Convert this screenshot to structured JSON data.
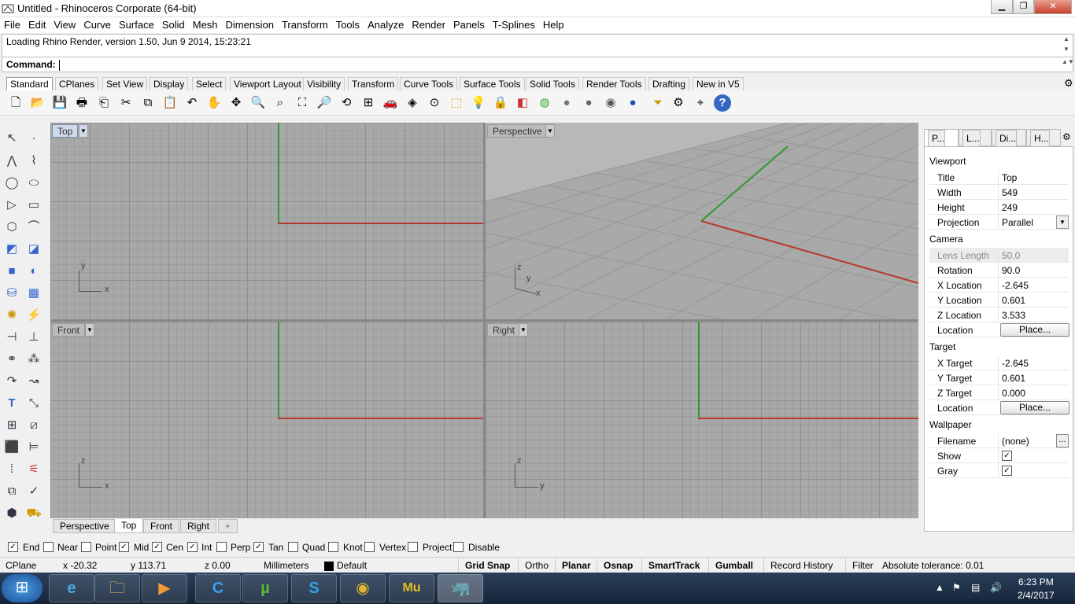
{
  "window": {
    "title": "Untitled - Rhinoceros Corporate (64-bit)"
  },
  "menu": [
    "File",
    "Edit",
    "View",
    "Curve",
    "Surface",
    "Solid",
    "Mesh",
    "Dimension",
    "Transform",
    "Tools",
    "Analyze",
    "Render",
    "Panels",
    "T-Splines",
    "Help"
  ],
  "history": {
    "line": "Loading Rhino Render, version 1.50, Jun  9 2014, 15:23:21"
  },
  "command": {
    "label": "Command:",
    "value": ""
  },
  "toolbar_tabs": [
    "Standard",
    "CPlanes",
    "Set View",
    "Display",
    "Select",
    "Viewport Layout",
    "Visibility",
    "Transform",
    "Curve Tools",
    "Surface Tools",
    "Solid Tools",
    "Render Tools",
    "Drafting",
    "New in V5"
  ],
  "toolbar_icons": [
    "new-icon",
    "open-icon",
    "save-icon",
    "print-icon",
    "import-icon",
    "cut-icon",
    "copy-icon",
    "paste-icon",
    "undo-icon",
    "pan-icon",
    "rotate-view-icon",
    "zoom-dynamic-icon",
    "zoom-window-icon",
    "zoom-extents-icon",
    "zoom-selected-icon",
    "undo-view-icon",
    "four-viewports-icon",
    "car-icon",
    "render-preview-icon",
    "cplane-icon",
    "select-icon",
    "light-icon",
    "lock-icon",
    "layer-icon",
    "color-wheel-icon",
    "shade-icon",
    "rendered-icon",
    "ghosted-icon",
    "material-icon",
    "filter-icon",
    "options-icon",
    "osnap-icon",
    "help-icon"
  ],
  "viewports": {
    "top": "Top",
    "perspective": "Perspective",
    "front": "Front",
    "right": "Right"
  },
  "axis_labels": {
    "top": [
      "y",
      "x"
    ],
    "perspective": [
      "z",
      "y",
      "x"
    ],
    "front": [
      "z",
      "x"
    ],
    "right": [
      "z",
      "y"
    ]
  },
  "viewport_tabs": [
    "Perspective",
    "Top",
    "Front",
    "Right",
    "+"
  ],
  "panel": {
    "tabs": [
      "P...",
      "L...",
      "Di...",
      "H..."
    ],
    "viewport_header": "Viewport",
    "title_label": "Title",
    "title_value": "Top",
    "width_label": "Width",
    "width_value": "549",
    "height_label": "Height",
    "height_value": "249",
    "projection_label": "Projection",
    "projection_value": "Parallel",
    "camera_header": "Camera",
    "lens_label": "Lens Length",
    "lens_value": "50.0",
    "rotation_label": "Rotation",
    "rotation_value": "90.0",
    "xloc_label": "X Location",
    "xloc_value": "-2.645",
    "yloc_label": "Y Location",
    "yloc_value": "0.601",
    "zloc_label": "Z Location",
    "zloc_value": "3.533",
    "location_label": "Location",
    "place_label": "Place...",
    "target_header": "Target",
    "xt_label": "X Target",
    "xt_value": "-2.645",
    "yt_label": "Y Target",
    "yt_value": "0.601",
    "zt_label": "Z Target",
    "zt_value": "0.000",
    "wallpaper_header": "Wallpaper",
    "filename_label": "Filename",
    "filename_value": "(none)",
    "browse_label": "...",
    "show_label": "Show",
    "gray_label": "Gray"
  },
  "osnaps": [
    {
      "label": "End",
      "checked": true
    },
    {
      "label": "Near",
      "checked": false
    },
    {
      "label": "Point",
      "checked": false
    },
    {
      "label": "Mid",
      "checked": true
    },
    {
      "label": "Cen",
      "checked": true
    },
    {
      "label": "Int",
      "checked": true
    },
    {
      "label": "Perp",
      "checked": false
    },
    {
      "label": "Tan",
      "checked": true
    },
    {
      "label": "Quad",
      "checked": false
    },
    {
      "label": "Knot",
      "checked": false
    },
    {
      "label": "Vertex",
      "checked": false
    },
    {
      "label": "Project",
      "checked": false
    },
    {
      "label": "Disable",
      "checked": false
    }
  ],
  "status": {
    "cplane": "CPlane",
    "x": "x -20.32",
    "y": "y 113.71",
    "z": "z 0.00",
    "units": "Millimeters",
    "layer": "Default",
    "grid_snap": "Grid Snap",
    "ortho": "Ortho",
    "planar": "Planar",
    "osnap": "Osnap",
    "smarttrack": "SmartTrack",
    "gumball": "Gumball",
    "record_history": "Record History",
    "filter": "Filter",
    "tolerance": "Absolute tolerance: 0.01"
  },
  "taskbar": {
    "apps": [
      "start-button",
      "ie-icon",
      "explorer-icon",
      "media-player-icon",
      "ccleaner-icon",
      "utorrent-icon",
      "skype-icon",
      "chrome-icon",
      "muse-icon",
      "rhino-icon"
    ],
    "time": "6:23 PM",
    "date": "2/4/2017",
    "muse_label": "Mu"
  },
  "colors": {
    "x_axis": "#b53a2e",
    "y_axis": "#2e9a2e",
    "viewport_bg": "#a8a8a8",
    "taskbar": "#1e2f47"
  }
}
